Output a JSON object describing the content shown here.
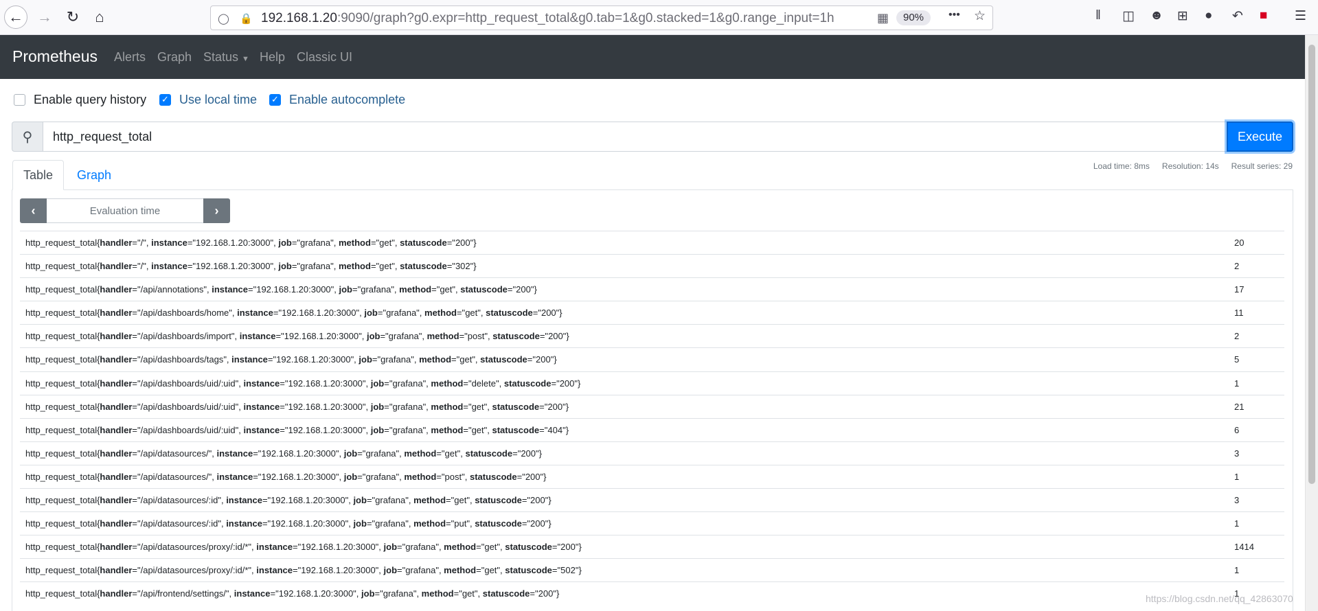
{
  "browser": {
    "url_host": "192.168.1.20",
    "url_rest": ":9090/graph?g0.expr=http_request_total&g0.tab=1&g0.stacked=1&g0.range_input=1h",
    "zoom": "90%"
  },
  "navbar": {
    "brand": "Prometheus",
    "links": [
      "Alerts",
      "Graph",
      "Status",
      "Help",
      "Classic UI"
    ]
  },
  "options": {
    "query_history": "Enable query history",
    "local_time": "Use local time",
    "autocomplete": "Enable autocomplete"
  },
  "query": {
    "expression": "http_request_total",
    "execute_label": "Execute"
  },
  "tabs": {
    "table": "Table",
    "graph": "Graph"
  },
  "stats": {
    "load_time": "Load time: 8ms",
    "resolution": "Resolution: 14s",
    "result_series": "Result series: 29"
  },
  "eval": {
    "placeholder": "Evaluation time",
    "prev": "‹",
    "next": "›"
  },
  "results": [
    {
      "handler": "/",
      "instance": "192.168.1.20:3000",
      "job": "grafana",
      "method": "get",
      "statuscode": "200",
      "value": "20"
    },
    {
      "handler": "/",
      "instance": "192.168.1.20:3000",
      "job": "grafana",
      "method": "get",
      "statuscode": "302",
      "value": "2"
    },
    {
      "handler": "/api/annotations",
      "instance": "192.168.1.20:3000",
      "job": "grafana",
      "method": "get",
      "statuscode": "200",
      "value": "17"
    },
    {
      "handler": "/api/dashboards/home",
      "instance": "192.168.1.20:3000",
      "job": "grafana",
      "method": "get",
      "statuscode": "200",
      "value": "11"
    },
    {
      "handler": "/api/dashboards/import",
      "instance": "192.168.1.20:3000",
      "job": "grafana",
      "method": "post",
      "statuscode": "200",
      "value": "2"
    },
    {
      "handler": "/api/dashboards/tags",
      "instance": "192.168.1.20:3000",
      "job": "grafana",
      "method": "get",
      "statuscode": "200",
      "value": "5"
    },
    {
      "handler": "/api/dashboards/uid/:uid",
      "instance": "192.168.1.20:3000",
      "job": "grafana",
      "method": "delete",
      "statuscode": "200",
      "value": "1"
    },
    {
      "handler": "/api/dashboards/uid/:uid",
      "instance": "192.168.1.20:3000",
      "job": "grafana",
      "method": "get",
      "statuscode": "200",
      "value": "21"
    },
    {
      "handler": "/api/dashboards/uid/:uid",
      "instance": "192.168.1.20:3000",
      "job": "grafana",
      "method": "get",
      "statuscode": "404",
      "value": "6"
    },
    {
      "handler": "/api/datasources/",
      "instance": "192.168.1.20:3000",
      "job": "grafana",
      "method": "get",
      "statuscode": "200",
      "value": "3"
    },
    {
      "handler": "/api/datasources/",
      "instance": "192.168.1.20:3000",
      "job": "grafana",
      "method": "post",
      "statuscode": "200",
      "value": "1"
    },
    {
      "handler": "/api/datasources/:id",
      "instance": "192.168.1.20:3000",
      "job": "grafana",
      "method": "get",
      "statuscode": "200",
      "value": "3"
    },
    {
      "handler": "/api/datasources/:id",
      "instance": "192.168.1.20:3000",
      "job": "grafana",
      "method": "put",
      "statuscode": "200",
      "value": "1"
    },
    {
      "handler": "/api/datasources/proxy/:id/*",
      "instance": "192.168.1.20:3000",
      "job": "grafana",
      "method": "get",
      "statuscode": "200",
      "value": "1414"
    },
    {
      "handler": "/api/datasources/proxy/:id/*",
      "instance": "192.168.1.20:3000",
      "job": "grafana",
      "method": "get",
      "statuscode": "502",
      "value": "1"
    },
    {
      "handler": "/api/frontend/settings/",
      "instance": "192.168.1.20:3000",
      "job": "grafana",
      "method": "get",
      "statuscode": "200",
      "value": "1"
    }
  ],
  "metric_name": "http_request_total",
  "watermark": "https://blog.csdn.net/qq_42863070"
}
